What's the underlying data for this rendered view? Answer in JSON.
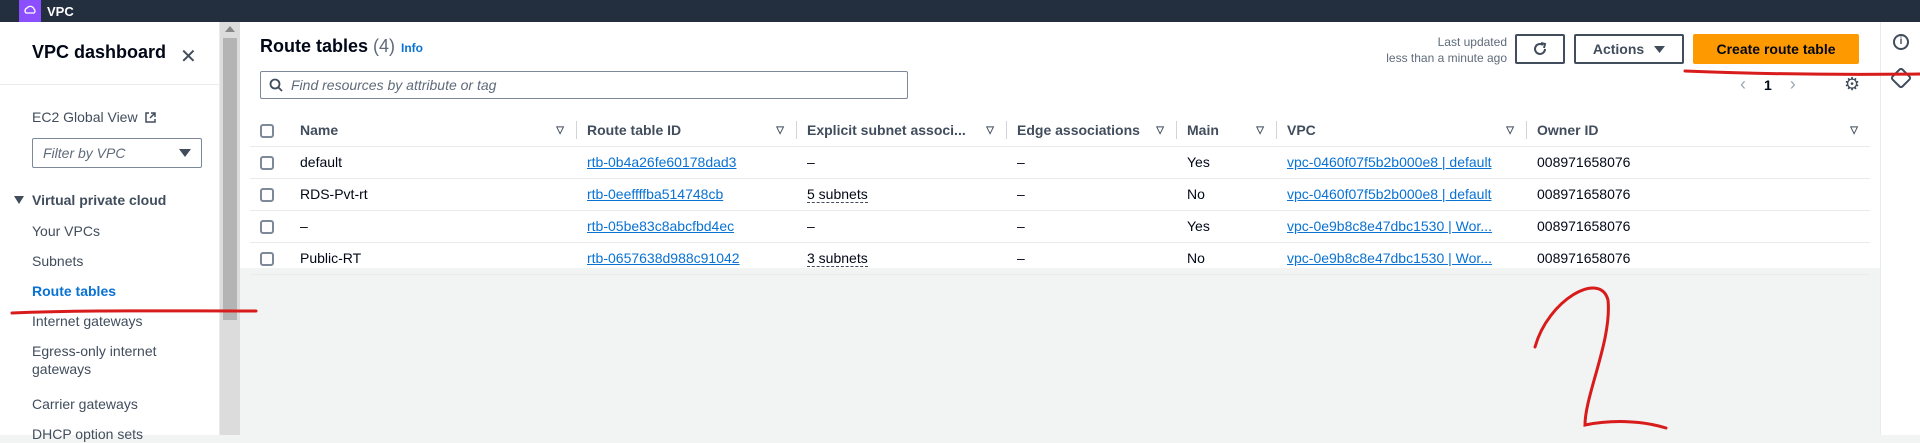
{
  "topbar": {
    "app_name": "VPC"
  },
  "sidebar": {
    "title": "VPC dashboard",
    "ec2_global_view": "EC2 Global View",
    "filter_placeholder": "Filter by VPC",
    "section": "Virtual private cloud",
    "items": [
      {
        "label": "Your VPCs"
      },
      {
        "label": "Subnets"
      },
      {
        "label": "Route tables"
      },
      {
        "label": "Internet gateways"
      },
      {
        "label": "Egress-only internet gateways"
      },
      {
        "label": "Carrier gateways"
      },
      {
        "label": "DHCP option sets"
      }
    ]
  },
  "header": {
    "title": "Route tables",
    "count": "(4)",
    "info": "Info",
    "last_updated_line1": "Last updated",
    "last_updated_line2": "less than a minute ago",
    "actions_label": "Actions",
    "create_label": "Create route table"
  },
  "search": {
    "placeholder": "Find resources by attribute or tag"
  },
  "pager": {
    "page": "1"
  },
  "table": {
    "columns": [
      "Name",
      "Route table ID",
      "Explicit subnet associ...",
      "Edge associations",
      "Main",
      "VPC",
      "Owner ID"
    ],
    "rows": [
      {
        "name": "default",
        "id": "rtb-0b4a26fe60178dad3",
        "explicit": "–",
        "edge": "–",
        "main": "Yes",
        "vpc": "vpc-0460f07f5b2b000e8 | default",
        "owner": "008971658076"
      },
      {
        "name": "RDS-Pvt-rt",
        "id": "rtb-0eeffffba514748cb",
        "explicit": "5 subnets",
        "edge": "–",
        "main": "No",
        "vpc": "vpc-0460f07f5b2b000e8 | default",
        "owner": "008971658076"
      },
      {
        "name": "–",
        "id": "rtb-05be83c8abcfbd4ec",
        "explicit": "–",
        "edge": "–",
        "main": "Yes",
        "vpc": "vpc-0e9b8c8e47dbc1530 | Wor...",
        "owner": "008971658076"
      },
      {
        "name": "Public-RT",
        "id": "rtb-0657638d988c91042",
        "explicit": "3 subnets",
        "edge": "–",
        "main": "No",
        "vpc": "vpc-0e9b8c8e47dbc1530 | Wor...",
        "owner": "008971658076"
      }
    ]
  },
  "colors": {
    "accent": "#0972d3",
    "primary_button": "#ff9900",
    "topbar": "#232f3e",
    "annotation": "#d81b1b"
  }
}
